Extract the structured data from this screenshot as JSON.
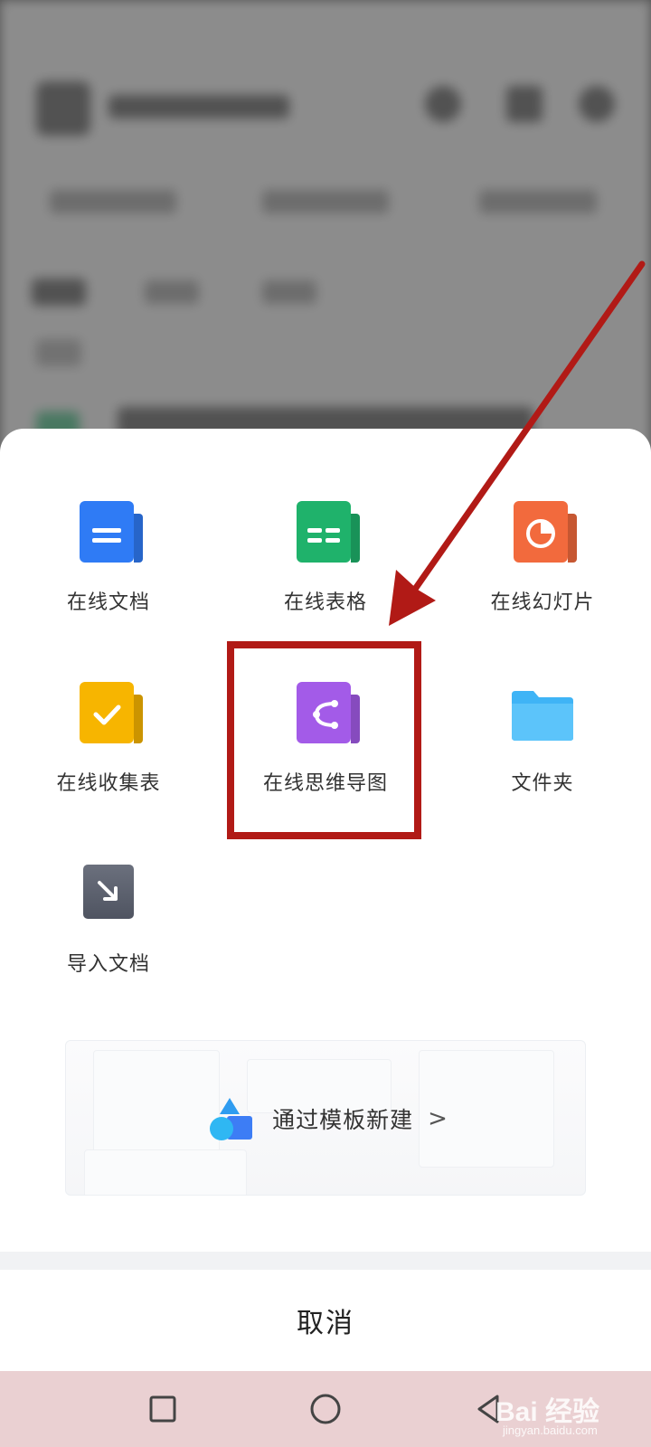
{
  "sheet": {
    "items": [
      {
        "label": "在线文档",
        "icon": "online-doc-icon",
        "color": "#2f7bf5"
      },
      {
        "label": "在线表格",
        "icon": "online-sheet-icon",
        "color": "#1fb26b"
      },
      {
        "label": "在线幻灯片",
        "icon": "online-slides-icon",
        "color": "#f26a3d"
      },
      {
        "label": "在线收集表",
        "icon": "online-form-icon",
        "color": "#f7b500"
      },
      {
        "label": "在线思维导图",
        "icon": "mind-map-icon",
        "color": "#a35be8"
      },
      {
        "label": "文件夹",
        "icon": "folder-icon",
        "color": "#3fb4f6"
      },
      {
        "label": "导入文档",
        "icon": "import-doc-icon",
        "color": "#5e6370"
      }
    ],
    "template": {
      "label": "通过模板新建",
      "chevron": ">"
    },
    "cancel_label": "取消"
  },
  "navbar": {
    "buttons": [
      "recent-apps",
      "home",
      "back"
    ]
  },
  "watermark": {
    "text": "Bai 经验",
    "url": "jingyan.baidu.com"
  }
}
